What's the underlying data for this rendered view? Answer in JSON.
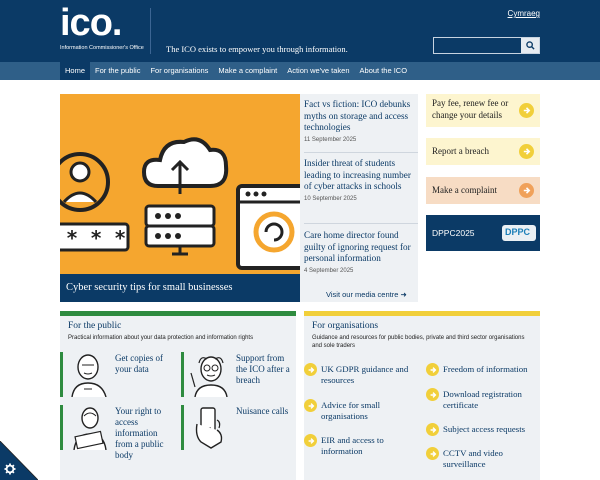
{
  "header": {
    "logo_text": "ico.",
    "logo_sub": "Information Commissioner's Office",
    "tagline": "The ICO exists to empower you through information.",
    "language_link": "Cymraeg",
    "search_placeholder": ""
  },
  "nav": {
    "items": [
      {
        "label": "Home",
        "active": true
      },
      {
        "label": "For the public",
        "active": false
      },
      {
        "label": "For organisations",
        "active": false
      },
      {
        "label": "Make a complaint",
        "active": false
      },
      {
        "label": "Action we've taken",
        "active": false
      },
      {
        "label": "About the ICO",
        "active": false
      }
    ]
  },
  "hero": {
    "caption": "Cyber security tips for small businesses"
  },
  "news": {
    "items": [
      {
        "title": "Fact vs fiction: ICO debunks myths on storage and access technologies",
        "date": "11 September 2025"
      },
      {
        "title": "Insider threat of students leading to increasing number of cyber attacks in schools",
        "date": "10 September 2025"
      },
      {
        "title": "Care home director found guilty of ignoring request for personal information",
        "date": "4 September 2025"
      }
    ],
    "media_link": "Visit our media centre"
  },
  "quick_links": {
    "pay_fee": "Pay fee, renew fee or change your details",
    "report_breach": "Report a breach",
    "make_complaint": "Make a complaint",
    "dppc_label": "DPPC2025",
    "dppc_logo": "DPPC"
  },
  "public": {
    "title": "For the public",
    "description": "Practical information about your data protection and information rights",
    "items": [
      {
        "label": "Get copies of your data"
      },
      {
        "label": "Support from the ICO after a breach"
      },
      {
        "label": "Your right to access information from a public body"
      },
      {
        "label": "Nuisance calls"
      }
    ]
  },
  "organisations": {
    "title": "For organisations",
    "description": "Guidance and resources for public bodies, private and third sector organisations and sole traders",
    "items": [
      {
        "label": "UK GDPR guidance and resources"
      },
      {
        "label": "Freedom of information"
      },
      {
        "label": "Advice for small organisations"
      },
      {
        "label": "Download registration certificate"
      },
      {
        "label": "EIR and access to information"
      },
      {
        "label": "Subject access requests"
      },
      {
        "label": "CCTV and video surveillance"
      }
    ]
  },
  "colors": {
    "brand_navy": "#0b3a66",
    "nav_blue": "#2f5f88",
    "hero_orange": "#f5a62f",
    "public_green": "#2e8b3f",
    "org_yellow": "#f1cf3a",
    "fee_bg": "#fdf5cf",
    "complaint_bg": "#f7dcc4",
    "complaint_arrow": "#f0a15a"
  }
}
